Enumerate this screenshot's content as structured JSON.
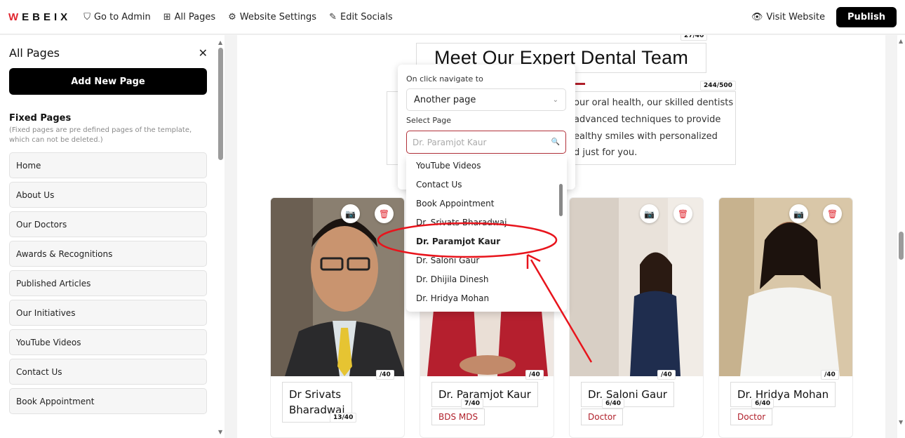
{
  "brand": {
    "logo_text": "WEBEIX"
  },
  "topbar": {
    "nav": [
      {
        "label": "Go to Admin",
        "icon": "shield-icon"
      },
      {
        "label": "All Pages",
        "icon": "grid-icon"
      },
      {
        "label": "Website Settings",
        "icon": "gear-icon"
      },
      {
        "label": "Edit Socials",
        "icon": "pencil-icon"
      }
    ],
    "visit_label": "Visit Website",
    "publish_label": "Publish"
  },
  "sidebar": {
    "title": "All Pages",
    "add_label": "Add New Page",
    "fixed_title": "Fixed Pages",
    "fixed_desc": "(Fixed pages are pre defined pages of the template, which can not be deleted.)",
    "items": [
      "Home",
      "About Us",
      "Our Doctors",
      "Awards & Recognitions",
      "Published Articles",
      "Our Initiatives",
      "YouTube Videos",
      "Contact Us",
      "Book Appointment"
    ]
  },
  "section": {
    "heading": "Meet Our Expert Dental Team",
    "heading_counter": "27/40",
    "para_counter": "244/500",
    "para_lines": [
      "our oral health, our skilled dentists",
      "advanced techniques to provide",
      "ealthy smiles with personalized",
      "d just for you."
    ]
  },
  "cards": [
    {
      "name_lines": [
        "Dr Srivats",
        "Bharadwaj"
      ],
      "counter_top": "/40",
      "counter_name": "13/40",
      "category": ""
    },
    {
      "name_lines": [
        "Dr. Paramjot Kaur"
      ],
      "counter_top": "/40",
      "counter_name": "7/40",
      "category": "BDS MDS"
    },
    {
      "name_lines": [
        "Dr. Saloni Gaur"
      ],
      "counter_top": "/40",
      "counter_name": "6/40",
      "category": "Doctor"
    },
    {
      "name_lines": [
        "Dr. Hridya Mohan"
      ],
      "counter_top": "/40",
      "counter_name": "6/40",
      "category": "Doctor"
    }
  ],
  "popover": {
    "navigate_label": "On click navigate to",
    "navigate_value": "Another page",
    "select_label": "Select Page",
    "search_placeholder": "Dr. Paramjot Kaur",
    "options": [
      "YouTube Videos",
      "Contact Us",
      "Book Appointment",
      "Dr. Srivats Bharadwaj",
      "Dr. Paramjot Kaur",
      "Dr. Saloni Gaur",
      "Dr. Dhijila Dinesh",
      "Dr. Hridya Mohan"
    ],
    "selected_option": "Dr. Paramjot Kaur"
  },
  "colors": {
    "accent": "#e0262f",
    "annotation": "#e8141c",
    "brand_dark": "#000000"
  }
}
